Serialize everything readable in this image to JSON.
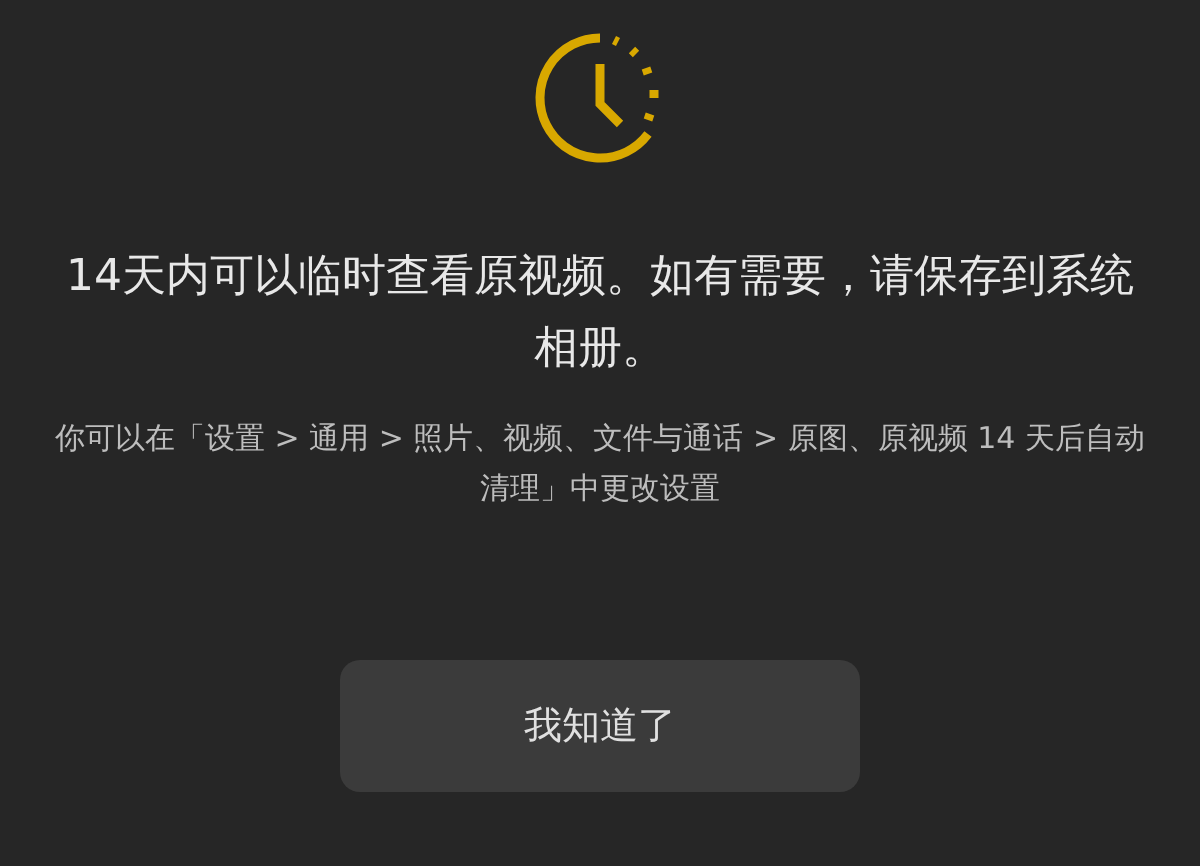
{
  "title": "14天内可以临时查看原视频。如有需要，请保存到系统相册。",
  "description": "你可以在「设置 > 通用 > 照片、视频、文件与通话 > 原图、原视频 14 天后自动清理」中更改设置",
  "button": "我知道了"
}
